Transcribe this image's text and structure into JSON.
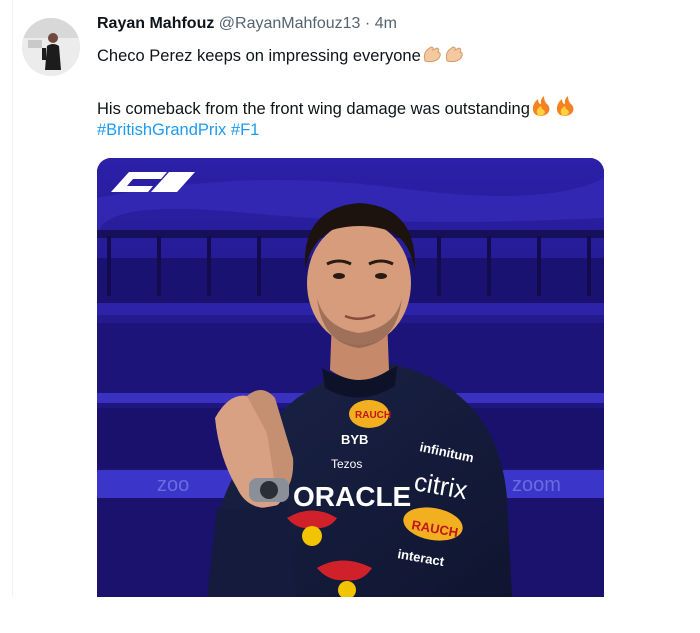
{
  "tweet": {
    "author_name": "Rayan Mahfouz",
    "handle": "@RayanMahfouz13",
    "separator": "·",
    "time": "4m",
    "text_line1": "Checo Perez keeps on impressing everyone",
    "text_line2": "His comeback from the front wing damage was outstanding",
    "hashtag1": "#BritishGrandPrix",
    "hashtag2": "#F1"
  },
  "media": {
    "logo_text": "F1",
    "banner_left": "zoo",
    "banner_right": "zoom",
    "suit_texts": [
      "RAUCH",
      "BYB",
      "Tezos",
      "ORACLE",
      "infinitum",
      "citrix",
      "RAUCH",
      "interact"
    ]
  },
  "icons": {
    "clap": "clapping-hands-icon",
    "fire": "fire-icon"
  },
  "colors": {
    "link": "#1d9bf0",
    "text": "#0f1419",
    "secondary": "#536471",
    "media_bg": "#241a8c"
  }
}
